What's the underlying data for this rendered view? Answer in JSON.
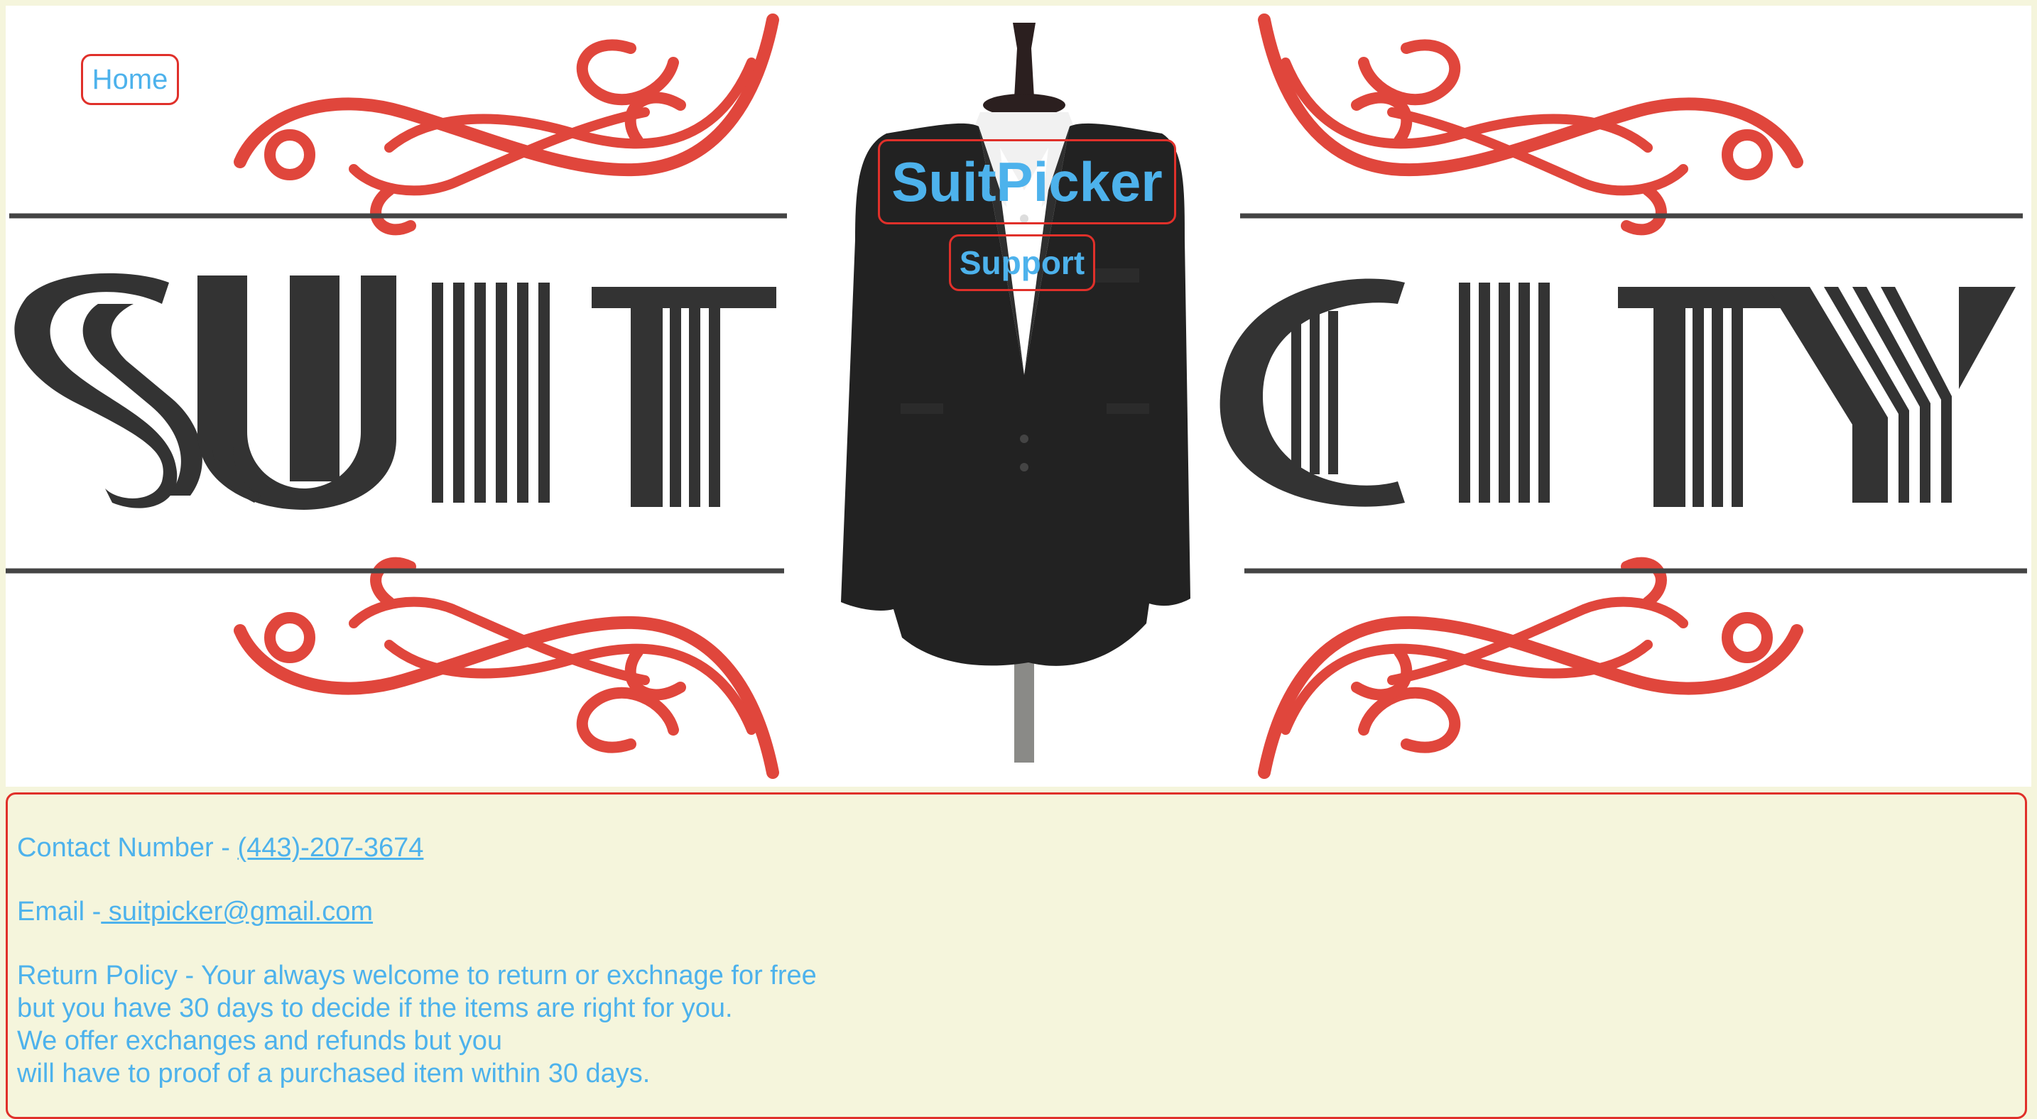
{
  "nav": {
    "home_label": "Home",
    "brand_title": "SuitPicker",
    "support_label": "Support"
  },
  "hero": {
    "logo_word_left": "SUIT",
    "logo_word_right": "CITY",
    "colors": {
      "ornament": "#e0463c",
      "letters": "#333333",
      "jacket": "#222222"
    }
  },
  "contact": {
    "phone_label": "Contact Number - ",
    "phone_value": "(443)-207-3674",
    "email_label": "Email -",
    "email_value": " suitpicker@gmail.com",
    "policy_lines": [
      "Return Policy - Your always welcome to return or exchnage for free",
      "but you have 30 days to decide if the items are right for you.",
      "We offer exchanges and refunds but you",
      "will have to proof of a purchased item within 30 days."
    ]
  },
  "colors": {
    "link": "#4db2ec",
    "border": "#e0302a",
    "background": "#f5f5dc"
  }
}
